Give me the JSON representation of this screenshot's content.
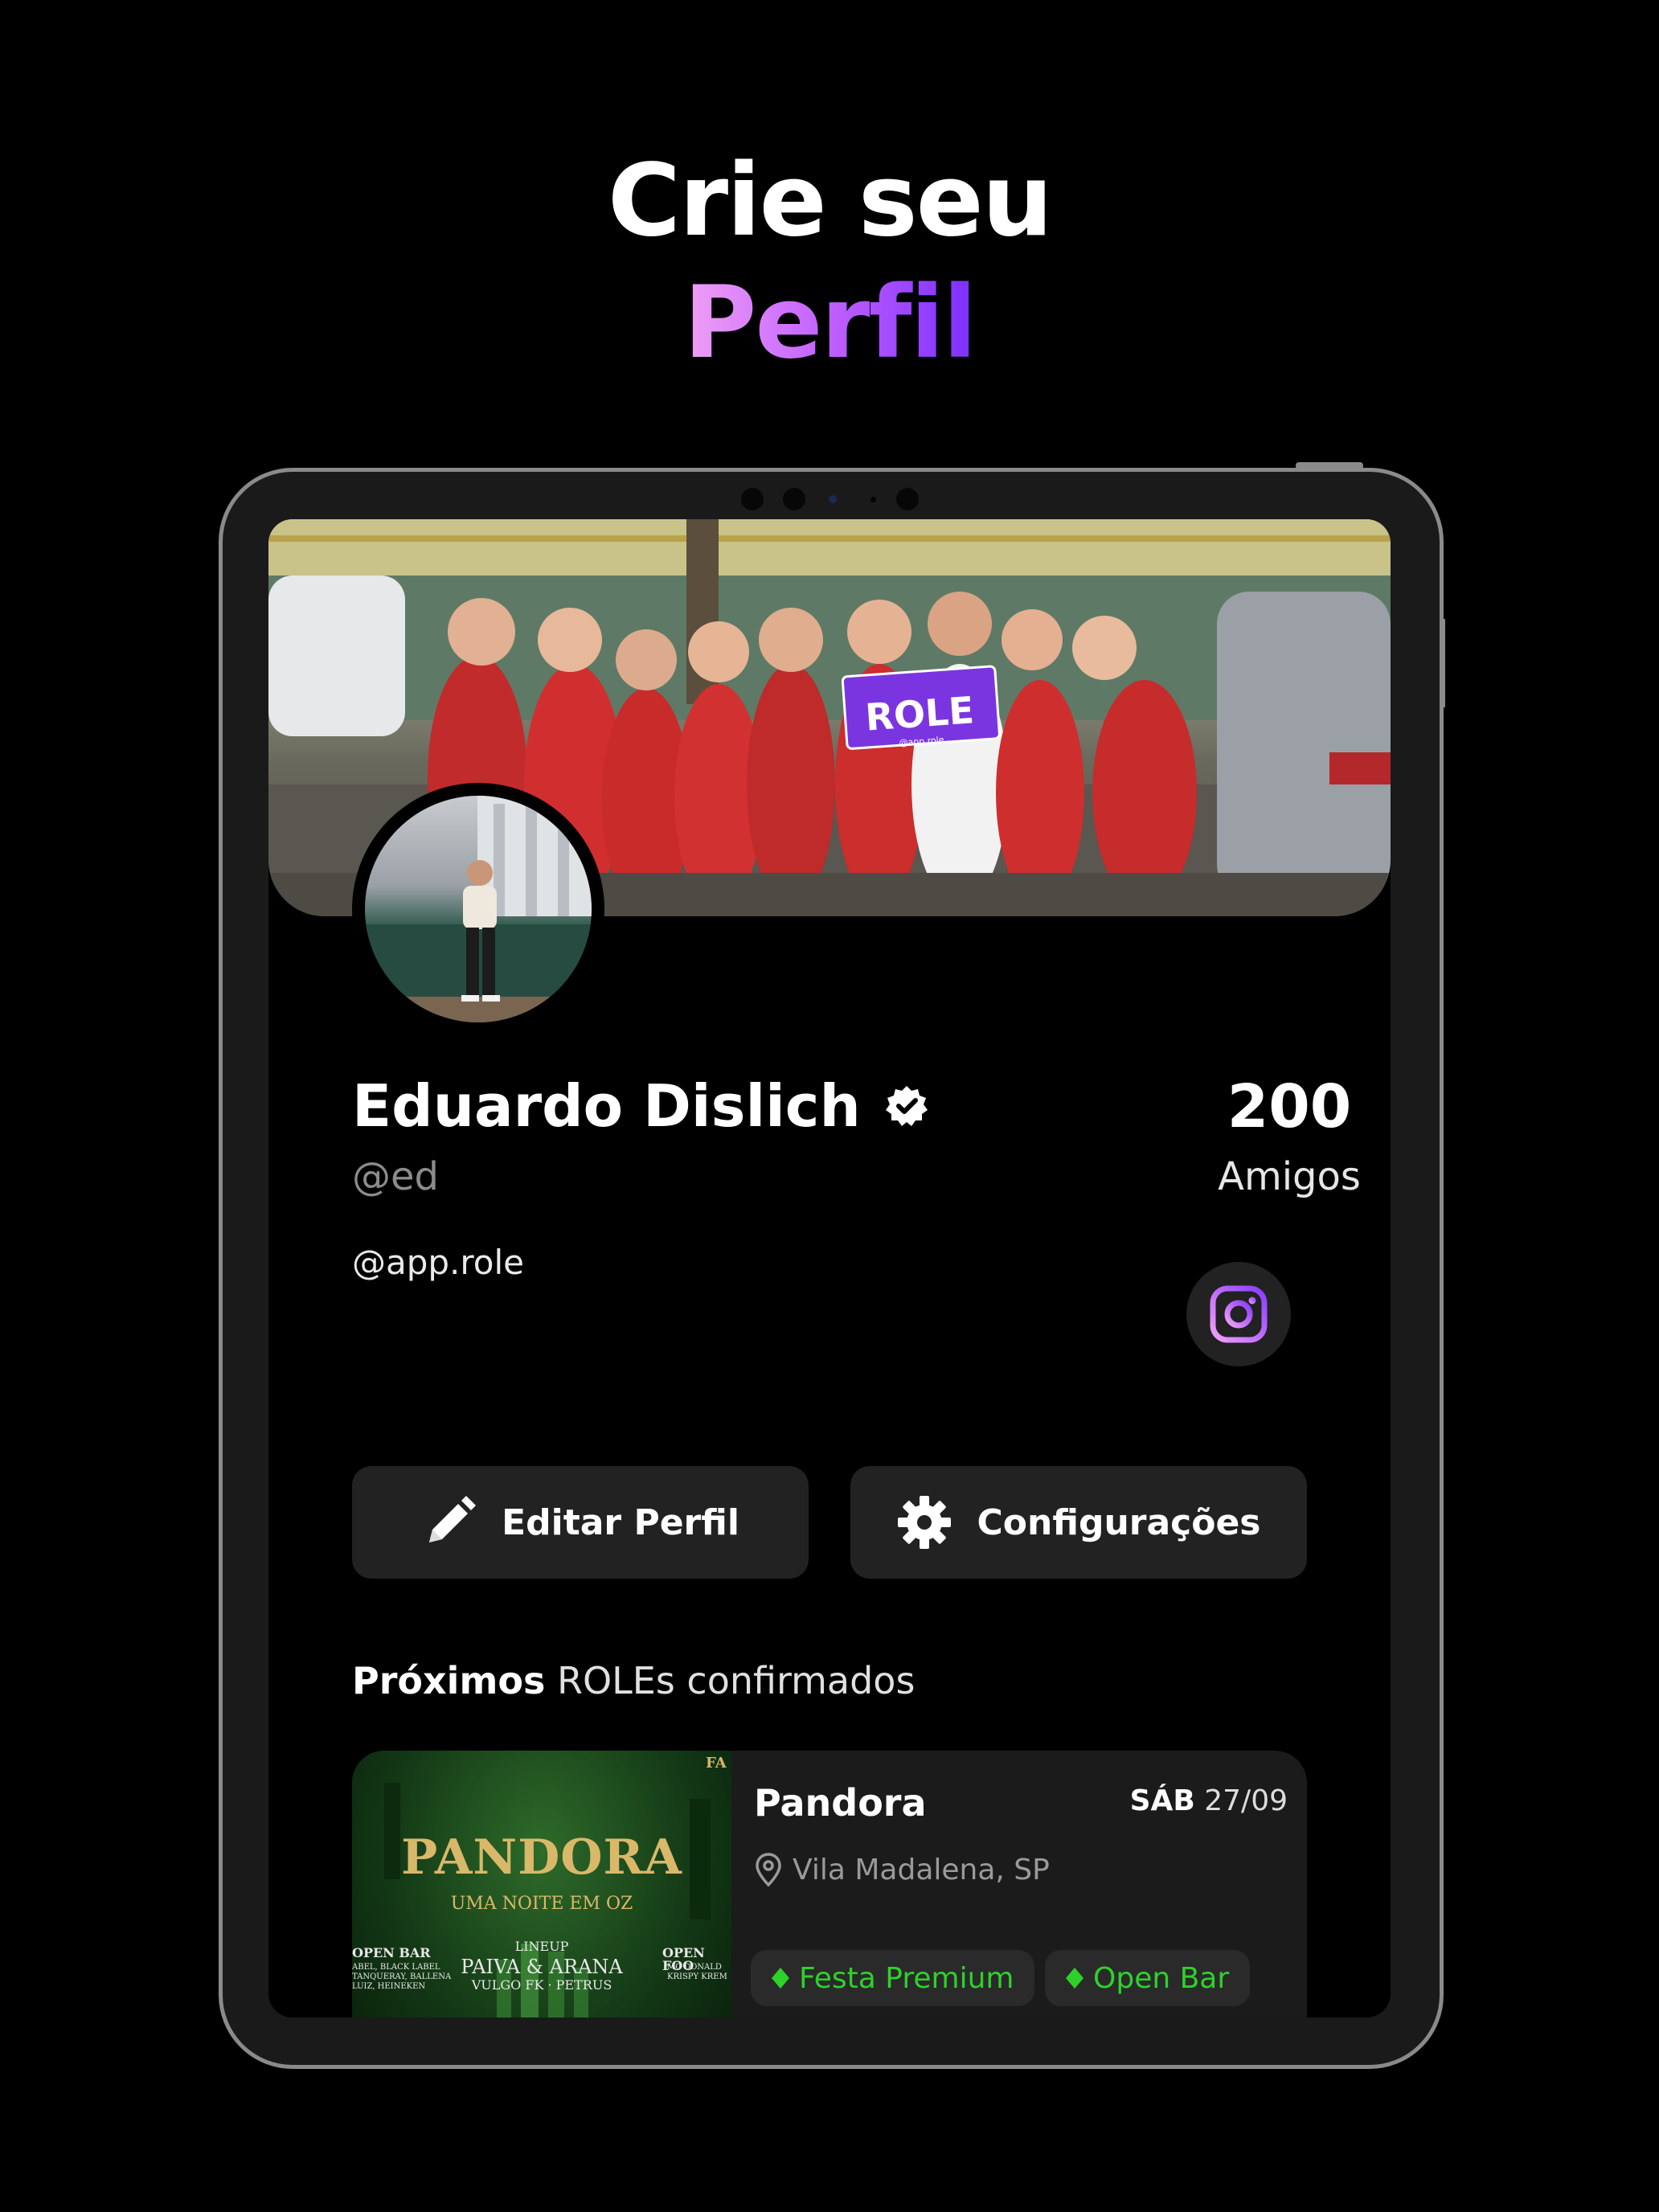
{
  "headline": {
    "line1": "Crie seu",
    "line2": "Perfil"
  },
  "cover": {
    "sign_text": "ROLE",
    "sign_handle": "@app.role"
  },
  "profile": {
    "name": "Eduardo Dislich",
    "username": "@ed",
    "link": "@app.role",
    "friends_count": "200",
    "friends_label": "Amigos",
    "verified_icon": "verified-badge-icon",
    "social_icon": "instagram-icon"
  },
  "actions": {
    "edit_label": "Editar Perfil",
    "edit_icon": "pencil-icon",
    "settings_label": "Configurações",
    "settings_icon": "gear-icon"
  },
  "section": {
    "title_bold": "Próximos",
    "title_rest": " ROLEs confirmados"
  },
  "event": {
    "poster_title": "PANDORA",
    "poster_subtitle": "UMA NOITE EM OZ",
    "poster_lineup_label": "LINEUP",
    "poster_lineup_1": "PAIVA & ARANA",
    "poster_lineup_2": "VULGO FK · PETRUS",
    "poster_openbar": "OPEN BAR",
    "poster_openbar_items": "ABEL, BLACK LABEL\nTANQUERAY, BALLENA\nLUIZ, HEINEKEN",
    "poster_openfood": "OPEN FOO",
    "poster_openfood_items": "MC DONALD\nKRISPY KREM",
    "poster_corner": "FA",
    "name": "Pandora",
    "day": "SÁB",
    "date": "27/09",
    "location": "Vila Madalena, SP",
    "tags": [
      "Festa Premium",
      "Open Bar"
    ]
  },
  "colors": {
    "background": "#000000",
    "accent_gradient_start": "#f0a0f5",
    "accent_gradient_end": "#7b2fff",
    "tag_green": "#2ed12a",
    "card": "#1b1b1b"
  }
}
